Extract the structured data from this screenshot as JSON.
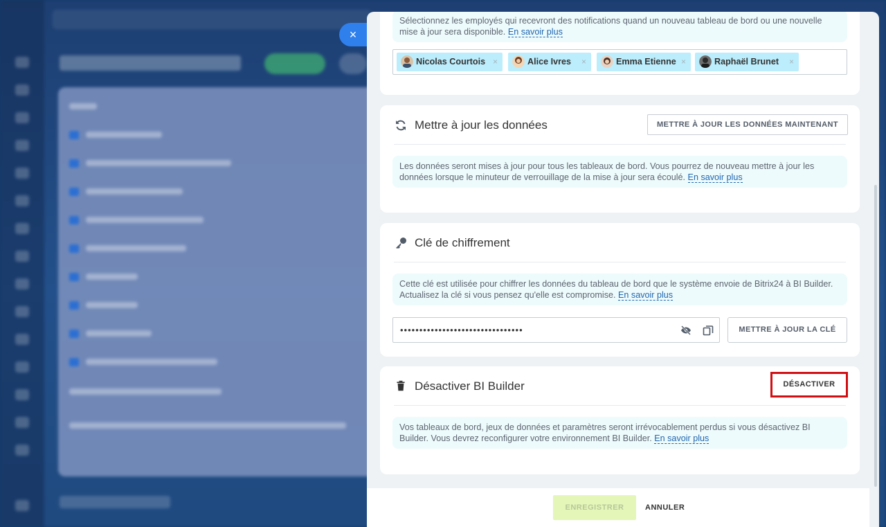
{
  "window": {
    "close_label": "×"
  },
  "notifications": {
    "description": "Sélectionnez les employés qui recevront des notifications quand un nouveau tableau de bord ou une nouvelle mise à jour sera disponible.",
    "learn_more": "En savoir plus",
    "recipients": [
      {
        "name": "Nicolas Courtois",
        "remove": "×"
      },
      {
        "name": "Alice Ivres",
        "remove": "×"
      },
      {
        "name": "Emma Etienne",
        "remove": "×"
      },
      {
        "name": "Raphaël Brunet",
        "remove": "×"
      }
    ]
  },
  "update_data": {
    "title": "Mettre à jour les données",
    "icon": "refresh-icon",
    "button": "METTRE À JOUR LES DONNÉES MAINTENANT",
    "description": "Les données seront mises à jour pour tous les tableaux de bord. Vous pourrez de nouveau mettre à jour les données lorsque le minuteur de verrouillage de la mise à jour sera écoulé.",
    "learn_more": "En savoir plus"
  },
  "encryption": {
    "title": "Clé de chiffrement",
    "icon": "key-icon",
    "description": "Cette clé est utilisée pour chiffrer les données du tableau de bord que le système envoie de Bitrix24 à BI Builder. Actualisez la clé si vous pensez qu'elle est compromise.",
    "learn_more": "En savoir plus",
    "key_masked": "••••••••••••••••••••••••••••••••",
    "button": "METTRE À JOUR LA CLÉ"
  },
  "deactivate": {
    "title": "Désactiver BI Builder",
    "icon": "trash-icon",
    "button": "DÉSACTIVER",
    "description": "Vos tableaux de bord, jeux de données et paramètres seront irrévocablement perdus si vous désactivez BI Builder. Vous devrez reconfigurer votre environnement BI Builder.",
    "learn_more": "En savoir plus"
  },
  "footer": {
    "save": "ENREGISTRER",
    "cancel": "ANNULER"
  },
  "colors": {
    "accent": "#2f80ed",
    "tag": "#bcedfc",
    "info_bg": "#eefbfc",
    "highlight": "#d10f13",
    "save_disabled": "#e4f6b8"
  }
}
